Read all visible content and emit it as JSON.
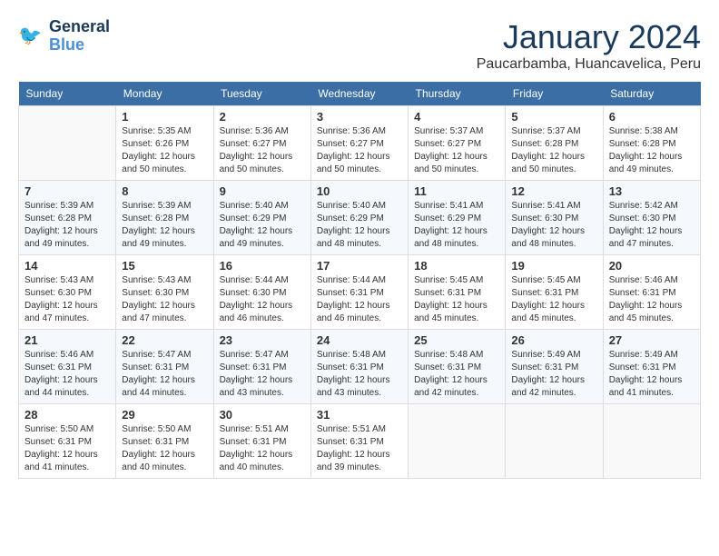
{
  "header": {
    "logo_line1": "General",
    "logo_line2": "Blue",
    "month": "January 2024",
    "location": "Paucarbamba, Huancavelica, Peru"
  },
  "weekdays": [
    "Sunday",
    "Monday",
    "Tuesday",
    "Wednesday",
    "Thursday",
    "Friday",
    "Saturday"
  ],
  "weeks": [
    [
      {
        "day": "",
        "info": ""
      },
      {
        "day": "1",
        "info": "Sunrise: 5:35 AM\nSunset: 6:26 PM\nDaylight: 12 hours\nand 50 minutes."
      },
      {
        "day": "2",
        "info": "Sunrise: 5:36 AM\nSunset: 6:27 PM\nDaylight: 12 hours\nand 50 minutes."
      },
      {
        "day": "3",
        "info": "Sunrise: 5:36 AM\nSunset: 6:27 PM\nDaylight: 12 hours\nand 50 minutes."
      },
      {
        "day": "4",
        "info": "Sunrise: 5:37 AM\nSunset: 6:27 PM\nDaylight: 12 hours\nand 50 minutes."
      },
      {
        "day": "5",
        "info": "Sunrise: 5:37 AM\nSunset: 6:28 PM\nDaylight: 12 hours\nand 50 minutes."
      },
      {
        "day": "6",
        "info": "Sunrise: 5:38 AM\nSunset: 6:28 PM\nDaylight: 12 hours\nand 49 minutes."
      }
    ],
    [
      {
        "day": "7",
        "info": "Sunrise: 5:39 AM\nSunset: 6:28 PM\nDaylight: 12 hours\nand 49 minutes."
      },
      {
        "day": "8",
        "info": "Sunrise: 5:39 AM\nSunset: 6:28 PM\nDaylight: 12 hours\nand 49 minutes."
      },
      {
        "day": "9",
        "info": "Sunrise: 5:40 AM\nSunset: 6:29 PM\nDaylight: 12 hours\nand 49 minutes."
      },
      {
        "day": "10",
        "info": "Sunrise: 5:40 AM\nSunset: 6:29 PM\nDaylight: 12 hours\nand 48 minutes."
      },
      {
        "day": "11",
        "info": "Sunrise: 5:41 AM\nSunset: 6:29 PM\nDaylight: 12 hours\nand 48 minutes."
      },
      {
        "day": "12",
        "info": "Sunrise: 5:41 AM\nSunset: 6:30 PM\nDaylight: 12 hours\nand 48 minutes."
      },
      {
        "day": "13",
        "info": "Sunrise: 5:42 AM\nSunset: 6:30 PM\nDaylight: 12 hours\nand 47 minutes."
      }
    ],
    [
      {
        "day": "14",
        "info": "Sunrise: 5:43 AM\nSunset: 6:30 PM\nDaylight: 12 hours\nand 47 minutes."
      },
      {
        "day": "15",
        "info": "Sunrise: 5:43 AM\nSunset: 6:30 PM\nDaylight: 12 hours\nand 47 minutes."
      },
      {
        "day": "16",
        "info": "Sunrise: 5:44 AM\nSunset: 6:30 PM\nDaylight: 12 hours\nand 46 minutes."
      },
      {
        "day": "17",
        "info": "Sunrise: 5:44 AM\nSunset: 6:31 PM\nDaylight: 12 hours\nand 46 minutes."
      },
      {
        "day": "18",
        "info": "Sunrise: 5:45 AM\nSunset: 6:31 PM\nDaylight: 12 hours\nand 45 minutes."
      },
      {
        "day": "19",
        "info": "Sunrise: 5:45 AM\nSunset: 6:31 PM\nDaylight: 12 hours\nand 45 minutes."
      },
      {
        "day": "20",
        "info": "Sunrise: 5:46 AM\nSunset: 6:31 PM\nDaylight: 12 hours\nand 45 minutes."
      }
    ],
    [
      {
        "day": "21",
        "info": "Sunrise: 5:46 AM\nSunset: 6:31 PM\nDaylight: 12 hours\nand 44 minutes."
      },
      {
        "day": "22",
        "info": "Sunrise: 5:47 AM\nSunset: 6:31 PM\nDaylight: 12 hours\nand 44 minutes."
      },
      {
        "day": "23",
        "info": "Sunrise: 5:47 AM\nSunset: 6:31 PM\nDaylight: 12 hours\nand 43 minutes."
      },
      {
        "day": "24",
        "info": "Sunrise: 5:48 AM\nSunset: 6:31 PM\nDaylight: 12 hours\nand 43 minutes."
      },
      {
        "day": "25",
        "info": "Sunrise: 5:48 AM\nSunset: 6:31 PM\nDaylight: 12 hours\nand 42 minutes."
      },
      {
        "day": "26",
        "info": "Sunrise: 5:49 AM\nSunset: 6:31 PM\nDaylight: 12 hours\nand 42 minutes."
      },
      {
        "day": "27",
        "info": "Sunrise: 5:49 AM\nSunset: 6:31 PM\nDaylight: 12 hours\nand 41 minutes."
      }
    ],
    [
      {
        "day": "28",
        "info": "Sunrise: 5:50 AM\nSunset: 6:31 PM\nDaylight: 12 hours\nand 41 minutes."
      },
      {
        "day": "29",
        "info": "Sunrise: 5:50 AM\nSunset: 6:31 PM\nDaylight: 12 hours\nand 40 minutes."
      },
      {
        "day": "30",
        "info": "Sunrise: 5:51 AM\nSunset: 6:31 PM\nDaylight: 12 hours\nand 40 minutes."
      },
      {
        "day": "31",
        "info": "Sunrise: 5:51 AM\nSunset: 6:31 PM\nDaylight: 12 hours\nand 39 minutes."
      },
      {
        "day": "",
        "info": ""
      },
      {
        "day": "",
        "info": ""
      },
      {
        "day": "",
        "info": ""
      }
    ]
  ]
}
